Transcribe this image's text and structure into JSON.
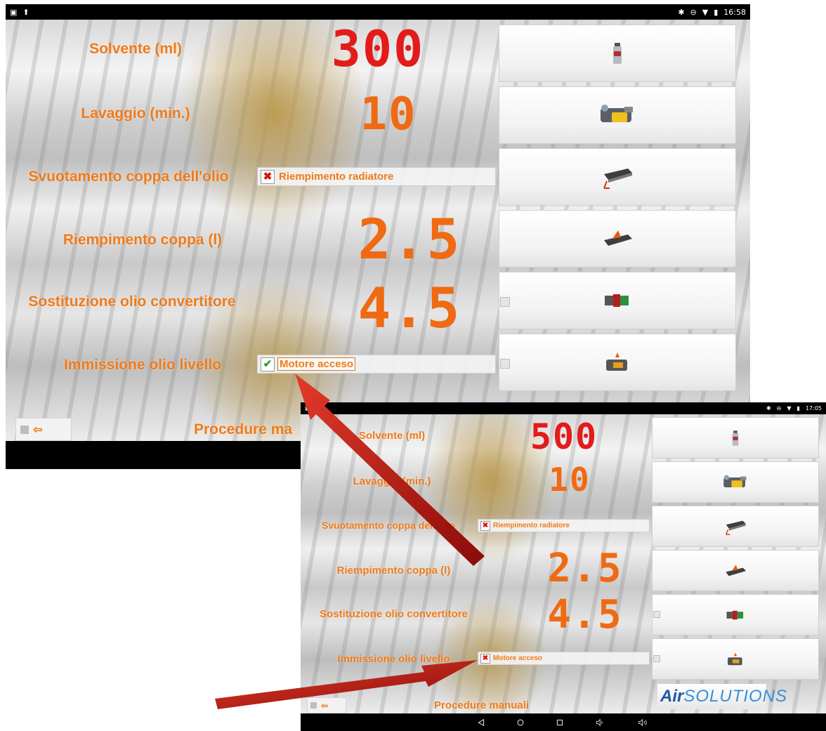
{
  "screen1": {
    "status_time": "16:58",
    "rows": [
      {
        "label": "Solvente (ml)"
      },
      {
        "label": "Lavaggio (min.)"
      },
      {
        "label": "Svuotamento coppa dell'olio"
      },
      {
        "label": "Riempimento coppa (l)"
      },
      {
        "label": "Sostituzione olio convertitore"
      },
      {
        "label": "Immissione olio livello"
      }
    ],
    "values": {
      "solvent": "300",
      "wash": "10",
      "sump_fill": "2.5",
      "converter": "4.5"
    },
    "options": {
      "radiator": {
        "label": "Riempimento radiatore",
        "checked": false
      },
      "engine": {
        "label": "Motore acceso",
        "checked": true
      }
    },
    "footer_label": "Procedure ma",
    "back_arrow": "⇦"
  },
  "screen2": {
    "status_time": "17:05",
    "rows": [
      {
        "label": "Solvente (ml)"
      },
      {
        "label": "Lavaggio (min.)"
      },
      {
        "label": "Svuotamento coppa dell'olio"
      },
      {
        "label": "Riempimento coppa (l)"
      },
      {
        "label": "Sostituzione olio convertitore"
      },
      {
        "label": "Immissione olio livello"
      }
    ],
    "values": {
      "solvent": "500",
      "wash": "10",
      "sump_fill": "2.5",
      "converter": "4.5"
    },
    "options": {
      "radiator": {
        "label": "Riempimento radiatore",
        "checked": false
      },
      "engine": {
        "label": "Motore acceso",
        "checked": false
      }
    },
    "footer_label": "Procedure manuali",
    "back_arrow": "⇦",
    "logo": {
      "part1": "Air",
      "part2": "SOLUTIONS"
    }
  },
  "nav_icons": [
    "back-triangle",
    "home-circle",
    "recents-square",
    "volume-down",
    "volume-up"
  ],
  "colors": {
    "label_orange": "#f07a18",
    "seg_red": "#e31b1b",
    "seg_orange": "#ef6a12",
    "annotation_red": "#c81a14"
  }
}
